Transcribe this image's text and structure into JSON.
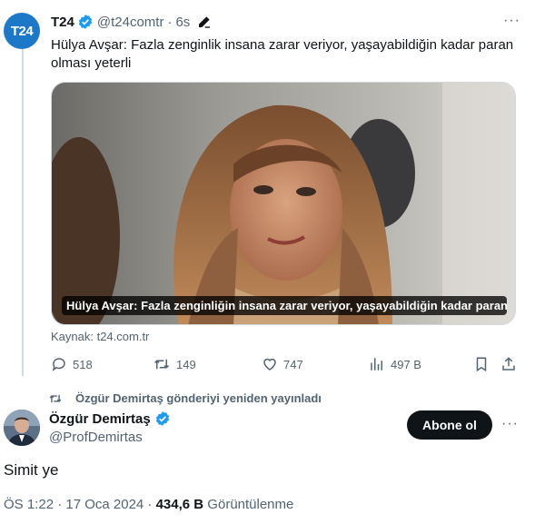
{
  "quoted_tweet": {
    "avatar_text": "T24",
    "name": "T24",
    "handle": "@t24comtr",
    "separator": "·",
    "time": "6s",
    "text": "Hülya Avşar: Fazla zenginlik insana zarar veriyor, yaşayabildiğin kadar paran olması yeterli",
    "card_caption": "Hülya Avşar: Fazla zenginliğin insana zarar veriyor, yaşayabildiğin kadar paran ol...",
    "source": "Kaynak: t24.com.tr",
    "actions": {
      "replies": "518",
      "retweets": "149",
      "likes": "747",
      "views": "497 B"
    }
  },
  "retweet_banner": "Özgür Demirtaş gönderiyi yeniden yayınladı",
  "main_tweet": {
    "name": "Özgür Demirtaş",
    "handle": "@ProfDemirtas",
    "follow_label": "Abone ol",
    "text": "Simit ye",
    "timestamp": "ÖS 1:22 · 17 Oca 2024 · ",
    "views_count": "434,6 B",
    "views_label": " Görüntülenme"
  },
  "colors": {
    "verified": "#1d9bf0",
    "secondary_text": "#536471",
    "primary_text": "#0f1419"
  }
}
